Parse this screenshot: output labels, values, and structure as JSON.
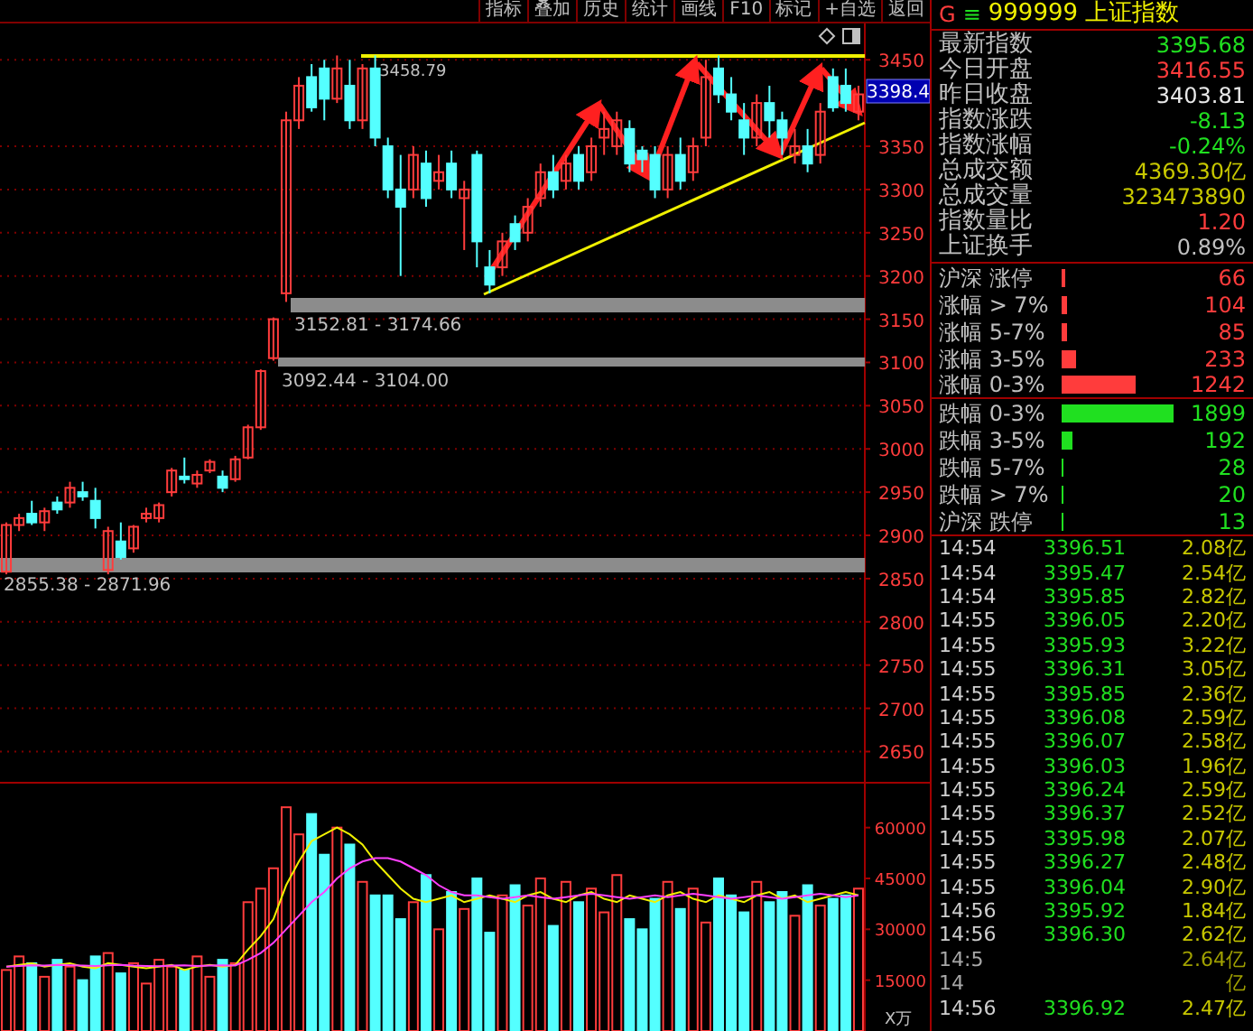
{
  "toolbar": [
    "指标",
    "叠加",
    "历史",
    "统计",
    "画线",
    "F10",
    "标记",
    "+自选",
    "返回"
  ],
  "high_label": "3458.79",
  "current_price": "3398.4",
  "price_chart": {
    "chart_data": {
      "type": "candlestick",
      "grid": true,
      "ylim": [
        2615,
        3492
      ],
      "yticks": [
        3450,
        3350,
        3300,
        3250,
        3200,
        3150,
        3100,
        3050,
        3000,
        2950,
        2900,
        2850,
        2800,
        2750,
        2700,
        2650
      ],
      "ohlc": [
        [
          2858,
          2915,
          2855,
          2912
        ],
        [
          2912,
          2925,
          2905,
          2920
        ],
        [
          2925,
          2940,
          2912,
          2915
        ],
        [
          2915,
          2932,
          2905,
          2928
        ],
        [
          2938,
          2945,
          2925,
          2930
        ],
        [
          2938,
          2962,
          2932,
          2955
        ],
        [
          2950,
          2962,
          2940,
          2945
        ],
        [
          2940,
          2955,
          2908,
          2920
        ],
        [
          2860,
          2910,
          2855,
          2905
        ],
        [
          2893,
          2915,
          2872,
          2875
        ],
        [
          2885,
          2912,
          2880,
          2910
        ],
        [
          2920,
          2932,
          2915,
          2925
        ],
        [
          2920,
          2938,
          2915,
          2935
        ],
        [
          2950,
          2978,
          2945,
          2975
        ],
        [
          2968,
          2990,
          2960,
          2965
        ],
        [
          2960,
          2975,
          2955,
          2970
        ],
        [
          2975,
          2988,
          2972,
          2985
        ],
        [
          2968,
          2975,
          2950,
          2955
        ],
        [
          2965,
          2992,
          2962,
          2988
        ],
        [
          2990,
          3028,
          2988,
          3025
        ],
        [
          3025,
          3092,
          3022,
          3090
        ],
        [
          3105,
          3152,
          3102,
          3150
        ],
        [
          3180,
          3390,
          3170,
          3380
        ],
        [
          3380,
          3430,
          3370,
          3420
        ],
        [
          3430,
          3445,
          3390,
          3395
        ],
        [
          3440,
          3450,
          3380,
          3405
        ],
        [
          3405,
          3455,
          3400,
          3440
        ],
        [
          3420,
          3450,
          3370,
          3380
        ],
        [
          3380,
          3445,
          3370,
          3440
        ],
        [
          3440,
          3455,
          3350,
          3360
        ],
        [
          3350,
          3360,
          3290,
          3300
        ],
        [
          3300,
          3340,
          3200,
          3280
        ],
        [
          3300,
          3350,
          3290,
          3340
        ],
        [
          3330,
          3345,
          3280,
          3290
        ],
        [
          3310,
          3340,
          3300,
          3320
        ],
        [
          3330,
          3345,
          3290,
          3300
        ],
        [
          3290,
          3310,
          3230,
          3300
        ],
        [
          3340,
          3345,
          3210,
          3240
        ],
        [
          3210,
          3230,
          3180,
          3190
        ],
        [
          3210,
          3250,
          3200,
          3240
        ],
        [
          3260,
          3270,
          3230,
          3240
        ],
        [
          3250,
          3290,
          3240,
          3280
        ],
        [
          3290,
          3330,
          3280,
          3320
        ],
        [
          3320,
          3340,
          3290,
          3300
        ],
        [
          3310,
          3340,
          3300,
          3330
        ],
        [
          3340,
          3350,
          3300,
          3310
        ],
        [
          3320,
          3360,
          3310,
          3350
        ],
        [
          3360,
          3390,
          3340,
          3370
        ],
        [
          3350,
          3390,
          3340,
          3380
        ],
        [
          3370,
          3380,
          3320,
          3330
        ],
        [
          3345,
          3350,
          3320,
          3335
        ],
        [
          3340,
          3350,
          3290,
          3300
        ],
        [
          3300,
          3350,
          3290,
          3340
        ],
        [
          3340,
          3360,
          3300,
          3310
        ],
        [
          3320,
          3360,
          3310,
          3350
        ],
        [
          3360,
          3450,
          3350,
          3430
        ],
        [
          3440,
          3455,
          3400,
          3410
        ],
        [
          3410,
          3430,
          3380,
          3390
        ],
        [
          3380,
          3400,
          3340,
          3360
        ],
        [
          3360,
          3410,
          3350,
          3400
        ],
        [
          3400,
          3420,
          3360,
          3380
        ],
        [
          3380,
          3390,
          3340,
          3360
        ],
        [
          3340,
          3370,
          3330,
          3350
        ],
        [
          3350,
          3370,
          3320,
          3330
        ],
        [
          3340,
          3400,
          3330,
          3390
        ],
        [
          3430,
          3440,
          3390,
          3395
        ],
        [
          3420,
          3440,
          3390,
          3400
        ],
        [
          3390,
          3420,
          3380,
          3410
        ]
      ]
    }
  },
  "zones": [
    {
      "label": "3152.81 - 3174.66"
    },
    {
      "label": "3092.44 - 3104.00"
    },
    {
      "label": "2855.38 - 2871.96"
    }
  ],
  "volume_chart": {
    "chart_data": {
      "type": "bar",
      "ylabel": "X万",
      "ylim": [
        0,
        73500
      ],
      "yticks": [
        60000,
        45000,
        30000,
        15000
      ],
      "series": [
        {
          "values": [
            18000,
            22000,
            20000,
            16000,
            21000,
            19000,
            15000,
            22000,
            23000,
            17000,
            20000,
            14000,
            21000,
            19000,
            18000,
            22000,
            16000,
            21000,
            20000,
            38000,
            42000,
            48000,
            66000,
            58000,
            64000,
            52000,
            60000,
            55000,
            44000,
            40000,
            40000,
            33000,
            38000,
            46000,
            30000,
            41000,
            36000,
            45000,
            29000,
            40000,
            43000,
            37000,
            45000,
            31000,
            44000,
            38000,
            42000,
            35000,
            46000,
            33000,
            30000,
            39000,
            44000,
            36000,
            42000,
            32000,
            45000,
            40000,
            35000,
            44000,
            38000,
            41000,
            34000,
            43000,
            37000,
            39000,
            40000,
            42000
          ]
        }
      ]
    }
  },
  "volume_average_chart": {
    "chart_data": {
      "type": "line",
      "ylim": [
        0,
        73500
      ],
      "series": [
        {
          "color": "#f0f000",
          "values": [
            19000,
            19500,
            20000,
            19000,
            19500,
            20000,
            19000,
            18500,
            20000,
            19500,
            19000,
            18500,
            19000,
            19500,
            18000,
            19000,
            19500,
            19000,
            19500,
            24000,
            28000,
            33000,
            43000,
            50000,
            56000,
            58000,
            60000,
            58000,
            55000,
            50000,
            46000,
            42000,
            39000,
            38000,
            39000,
            40000,
            38000,
            39000,
            40000,
            39000,
            38000,
            40000,
            41000,
            39000,
            38000,
            40000,
            41000,
            39000,
            38000,
            40000,
            39000,
            38000,
            40000,
            41000,
            39000,
            38000,
            40000,
            39000,
            38000,
            40000,
            41000,
            39000,
            40000,
            38000,
            39000,
            40000,
            41000,
            40000
          ]
        },
        {
          "color": "#ff40ff",
          "values": [
            19000,
            19200,
            19400,
            19300,
            19500,
            19400,
            19300,
            19200,
            19400,
            19500,
            19300,
            19200,
            19100,
            19300,
            19400,
            19200,
            19300,
            19400,
            19300,
            21000,
            23000,
            26000,
            30000,
            34000,
            38000,
            41000,
            45000,
            48000,
            50000,
            51000,
            51000,
            50000,
            48000,
            46000,
            43000,
            41000,
            40000,
            40000,
            39500,
            39000,
            39500,
            40000,
            39500,
            39000,
            39500,
            40000,
            40500,
            40000,
            39500,
            39000,
            39500,
            40000,
            39500,
            40000,
            40500,
            40000,
            39500,
            39000,
            39500,
            40000,
            39500,
            39000,
            39500,
            40000,
            40500,
            40000,
            39500,
            40000
          ]
        }
      ]
    }
  },
  "header": {
    "prefix": "G",
    "menu_glyph": "≡",
    "title": "999999 上证指数"
  },
  "stats": [
    {
      "label": "最新指数",
      "value": "3395.68",
      "color": "#20e020"
    },
    {
      "label": "今日开盘",
      "value": "3416.55",
      "color": "#ff3c3c"
    },
    {
      "label": "昨日收盘",
      "value": "3403.81",
      "color": "#e8e8e8"
    },
    {
      "label": "指数涨跌",
      "value": "-8.13",
      "color": "#20e020"
    },
    {
      "label": "指数涨幅",
      "value": "-0.24%",
      "color": "#20e020"
    },
    {
      "label": "总成交额",
      "value": "4369.30亿",
      "color": "#c8c800"
    },
    {
      "label": "总成交量",
      "value": "323473890",
      "color": "#c8c800"
    },
    {
      "label": "指数量比",
      "value": "1.20",
      "color": "#ff3c3c"
    },
    {
      "label": "上证换手",
      "value": "0.89%",
      "color": "#c0c0c0"
    }
  ],
  "breadth": [
    {
      "label": "沪深 涨停",
      "count": "66",
      "color": "#ff3c3c"
    },
    {
      "label": "涨幅 > 7%",
      "count": "104",
      "color": "#ff3c3c"
    },
    {
      "label": "涨幅 5-7%",
      "count": "85",
      "color": "#ff3c3c"
    },
    {
      "label": "涨幅 3-5%",
      "count": "233",
      "color": "#ff3c3c"
    },
    {
      "label": "涨幅 0-3%",
      "count": "1242",
      "color": "#ff3c3c"
    },
    {
      "label": "跌幅 0-3%",
      "count": "1899",
      "color": "#20e020"
    },
    {
      "label": "跌幅 3-5%",
      "count": "192",
      "color": "#20e020"
    },
    {
      "label": "跌幅 5-7%",
      "count": "28",
      "color": "#20e020"
    },
    {
      "label": "跌幅 > 7%",
      "count": "20",
      "color": "#20e020"
    },
    {
      "label": "沪深 跌停",
      "count": "13",
      "color": "#20e020"
    }
  ],
  "ticks": [
    {
      "time": "14:54",
      "price": "3396.51",
      "volume": "2.08亿"
    },
    {
      "time": "14:54",
      "price": "3395.47",
      "volume": "2.54亿"
    },
    {
      "time": "14:54",
      "price": "3395.85",
      "volume": "2.82亿"
    },
    {
      "time": "14:55",
      "price": "3396.05",
      "volume": "2.20亿"
    },
    {
      "time": "14:55",
      "price": "3395.93",
      "volume": "3.22亿"
    },
    {
      "time": "14:55",
      "price": "3396.31",
      "volume": "3.05亿"
    },
    {
      "time": "14:55",
      "price": "3395.85",
      "volume": "2.36亿"
    },
    {
      "time": "14:55",
      "price": "3396.08",
      "volume": "2.59亿"
    },
    {
      "time": "14:55",
      "price": "3396.07",
      "volume": "2.58亿"
    },
    {
      "time": "14:55",
      "price": "3396.03",
      "volume": "1.96亿"
    },
    {
      "time": "14:55",
      "price": "3396.24",
      "volume": "2.59亿"
    },
    {
      "time": "14:55",
      "price": "3396.37",
      "volume": "2.52亿"
    },
    {
      "time": "14:55",
      "price": "3395.98",
      "volume": "2.07亿"
    },
    {
      "time": "14:55",
      "price": "3396.27",
      "volume": "2.48亿"
    },
    {
      "time": "14:55",
      "price": "3396.04",
      "volume": "2.90亿"
    },
    {
      "time": "14:56",
      "price": "3395.92",
      "volume": "1.84亿"
    },
    {
      "time": "14:56",
      "price": "3396.30",
      "volume": "2.62亿"
    },
    {
      "time": "14:5",
      "volume": "2.64亿",
      "kind": "partial"
    },
    {
      "time": "14",
      "volume": "亿",
      "kind": "partial"
    },
    {
      "time": "14:56",
      "price": "3396.92",
      "volume": "2.47亿"
    }
  ]
}
